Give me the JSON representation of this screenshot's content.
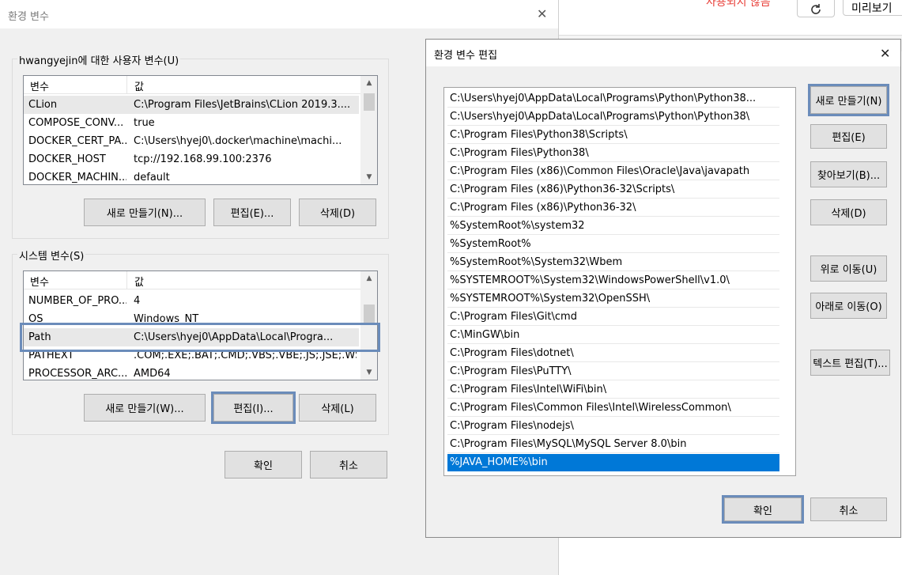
{
  "background_app": {
    "status_text": "사용되지 않음",
    "preview_button": "미리보기"
  },
  "env_dialog": {
    "title": "환경 변수",
    "user_group_label": "hwangyejin에 대한 사용자 변수(U)",
    "col_name": "변수",
    "col_value": "값",
    "user_vars": [
      {
        "name": "CLion",
        "value": "C:\\Program Files\\JetBrains\\CLion 2019.3...."
      },
      {
        "name": "COMPOSE_CONV...",
        "value": "true"
      },
      {
        "name": "DOCKER_CERT_PA...",
        "value": "C:\\Users\\hyej0\\.docker\\machine\\machi..."
      },
      {
        "name": "DOCKER_HOST",
        "value": "tcp://192.168.99.100:2376"
      },
      {
        "name": "DOCKER_MACHIN...",
        "value": "default"
      }
    ],
    "user_buttons": {
      "new": "새로 만들기(N)...",
      "edit": "편집(E)...",
      "delete": "삭제(D)"
    },
    "system_group_label": "시스템 변수(S)",
    "system_vars": [
      {
        "name": "NUMBER_OF_PRO...",
        "value": "4"
      },
      {
        "name": "OS",
        "value": "Windows_NT"
      },
      {
        "name": "Path",
        "value": "C:\\Users\\hyej0\\AppData\\Local\\Progra..."
      },
      {
        "name": "PATHEXT",
        "value": ".COM;.EXE;.BAT;.CMD;.VBS;.VBE;.JS;.JSE;.WS..."
      },
      {
        "name": "PROCESSOR_ARC...",
        "value": "AMD64"
      }
    ],
    "system_buttons": {
      "new": "새로 만들기(W)...",
      "edit": "편집(I)...",
      "delete": "삭제(L)"
    },
    "ok": "확인",
    "cancel": "취소"
  },
  "edit_dialog": {
    "title": "환경 변수 편집",
    "paths": [
      "C:\\Users\\hyej0\\AppData\\Local\\Programs\\Python\\Python38...",
      "C:\\Users\\hyej0\\AppData\\Local\\Programs\\Python\\Python38\\",
      "C:\\Program Files\\Python38\\Scripts\\",
      "C:\\Program Files\\Python38\\",
      "C:\\Program Files (x86)\\Common Files\\Oracle\\Java\\javapath",
      "C:\\Program Files (x86)\\Python36-32\\Scripts\\",
      "C:\\Program Files (x86)\\Python36-32\\",
      "%SystemRoot%\\system32",
      "%SystemRoot%",
      "%SystemRoot%\\System32\\Wbem",
      "%SYSTEMROOT%\\System32\\WindowsPowerShell\\v1.0\\",
      "%SYSTEMROOT%\\System32\\OpenSSH\\",
      "C:\\Program Files\\Git\\cmd",
      "C:\\MinGW\\bin",
      "C:\\Program Files\\dotnet\\",
      "C:\\Program Files\\PuTTY\\",
      "C:\\Program Files\\Intel\\WiFi\\bin\\",
      "C:\\Program Files\\Common Files\\Intel\\WirelessCommon\\",
      "C:\\Program Files\\nodejs\\",
      "C:\\Program Files\\MySQL\\MySQL Server 8.0\\bin",
      "%JAVA_HOME%\\bin"
    ],
    "selected_index": 20,
    "buttons": {
      "new": "새로 만들기(N)",
      "edit": "편집(E)",
      "browse": "찾아보기(B)...",
      "delete": "삭제(D)",
      "up": "위로 이동(U)",
      "down": "아래로 이동(O)",
      "text_edit": "텍스트 편집(T)..."
    },
    "ok": "확인",
    "cancel": "취소"
  },
  "colors": {
    "highlight": "#6b8cba",
    "selection": "#0078d7",
    "status_red": "#e8403a"
  }
}
